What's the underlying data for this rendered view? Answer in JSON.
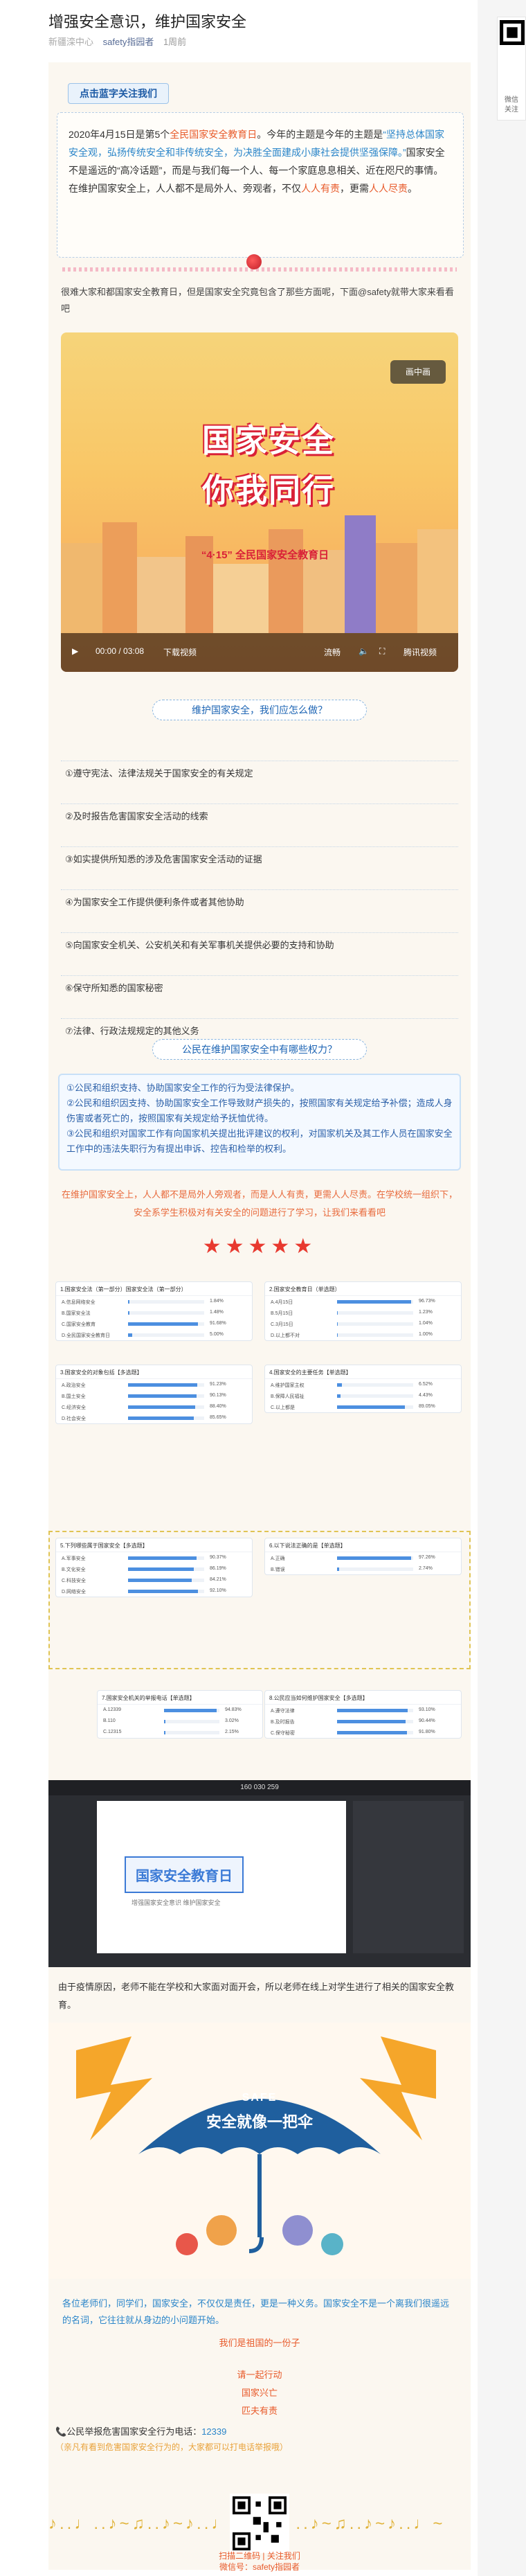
{
  "article": {
    "title": "增强安全意识，维护国家安全",
    "source": "新疆滦中心",
    "account": "safety指园者",
    "date": "1周前"
  },
  "side_qr": {
    "label": "微信\n关注"
  },
  "notice": {
    "heading": "点击蓝字关注我们",
    "p1_a": "2020年4月15日是第5个",
    "p1_b": "全民国家安全教育日",
    "p1_c": "。今年的主题是今年的主题是",
    "p1_d": "“坚持总体国家安全观，弘扬传统安全和非传统安全，为决胜全面建成小康社会提供坚强保障。”",
    "p1_e": "国家安全不是遥远的“高冷话题”，而是与我们每一个人、每一个家庭息息相关、近在咫尺的事情。",
    "p2_a": "在维护国家安全上，人人都不是局外人、旁观者，不仅",
    "p2_b": "人人有责",
    "p2_c": "，更需",
    "p2_d": "人人尽责",
    "p2_e": "。"
  },
  "intro": "很难大家和都国家安全教育日，但是国家安全究竟包含了那些方面呢，下面@safety就带大家来看看吧",
  "video": {
    "badge": "画中画",
    "title_line1": "国家安全",
    "title_line2": "你我同行",
    "subtitle": "“4·15” 全民国家安全教育日",
    "time": "00:00 / 03:08",
    "download": "下载视频",
    "quality": "流畅",
    "brand": "腾讯视频"
  },
  "section2": {
    "title": "维护国家安全，我们应怎么做？",
    "items": [
      "①遵守宪法、法律法规关于国家安全的有关规定",
      "②及时报告危害国家安全活动的线索",
      "③如实提供所知悉的涉及危害国家安全活动的证据",
      "④为国家安全工作提供便利条件或者其他协助",
      "⑤向国家安全机关、公安机关和有关军事机关提供必要的支持和协助",
      "⑥保守所知悉的国家秘密",
      "⑦法律、行政法规规定的其他义务"
    ]
  },
  "section3": {
    "title": "公民在维护国家安全中有哪些权力？",
    "rights": [
      "①公民和组织支持、协助国家安全工作的行为受法律保护。",
      "②公民和组织因支持、协助国家安全工作导致财产损失的，按照国家有关规定给予补偿；造成人身伤害或者死亡的，按照国家有关规定给予抚恤优待。",
      "③公民和组织对国家工作有向国家机关提出批评建议的权利，对国家机关及其工作人员在国家安全工作中的违法失职行为有提出申诉、控告和检举的权利。"
    ],
    "note": "在维护国家安全上，人人都不是局外人旁观者，而是人人有责，更需人人尽责。在学校统一组织下，安全系学生积极对有关安全的问题进行了学习，让我们来看看吧",
    "stars": "★★★★★"
  },
  "survey": {
    "panels": [
      {
        "head": "1.国家安全法（第一部分）国家安全法（第一部分）",
        "rows": [
          {
            "label": "A.信息网络安全",
            "pct": "1.84%",
            "val": 0.02
          },
          {
            "label": "B.国家安全法",
            "pct": "1.48%",
            "val": 0.015
          },
          {
            "label": "C.国家安全教育",
            "pct": "91.68%",
            "val": 0.92
          },
          {
            "label": "D.全民国家安全教育日",
            "pct": "5.00%",
            "val": 0.05
          }
        ]
      },
      {
        "head": "2.国家安全教育日（单选题）",
        "rows": [
          {
            "label": "A.4月15日",
            "pct": "96.73%",
            "val": 0.97
          },
          {
            "label": "B.5月15日",
            "pct": "1.23%",
            "val": 0.012
          },
          {
            "label": "C.3月15日",
            "pct": "1.04%",
            "val": 0.01
          },
          {
            "label": "D.以上都不对",
            "pct": "1.00%",
            "val": 0.01
          }
        ]
      },
      {
        "head": "3.国家安全的对象包括【多选题】",
        "rows": [
          {
            "label": "A.政治安全",
            "pct": "91.23%",
            "val": 0.91
          },
          {
            "label": "B.国土安全",
            "pct": "90.13%",
            "val": 0.9
          },
          {
            "label": "C.经济安全",
            "pct": "88.40%",
            "val": 0.88
          },
          {
            "label": "D.社会安全",
            "pct": "85.65%",
            "val": 0.86
          }
        ]
      },
      {
        "head": "4.国家安全的主要任务【单选题】",
        "rows": [
          {
            "label": "A.维护国家主权",
            "pct": "6.52%",
            "val": 0.065
          },
          {
            "label": "B.保障人民福祉",
            "pct": "4.43%",
            "val": 0.044
          },
          {
            "label": "C.以上都是",
            "pct": "89.05%",
            "val": 0.89
          }
        ]
      },
      {
        "head": "5.下列哪些属于国家安全【多选题】",
        "rows": [
          {
            "label": "A.军事安全",
            "pct": "90.37%",
            "val": 0.9
          },
          {
            "label": "B.文化安全",
            "pct": "86.19%",
            "val": 0.86
          },
          {
            "label": "C.科技安全",
            "pct": "84.21%",
            "val": 0.84
          },
          {
            "label": "D.网络安全",
            "pct": "92.10%",
            "val": 0.92
          }
        ]
      },
      {
        "head": "6.以下说法正确的是【单选题】",
        "rows": [
          {
            "label": "A.正确",
            "pct": "97.26%",
            "val": 0.97
          },
          {
            "label": "B.错误",
            "pct": "2.74%",
            "val": 0.027
          }
        ]
      },
      {
        "head": "7.国家安全机关的举报电话【单选题】",
        "rows": [
          {
            "label": "A.12339",
            "pct": "94.83%",
            "val": 0.95
          },
          {
            "label": "B.110",
            "pct": "3.02%",
            "val": 0.03
          },
          {
            "label": "C.12315",
            "pct": "2.15%",
            "val": 0.02
          }
        ]
      },
      {
        "head": "8.公民应当如何维护国家安全【多选题】",
        "rows": [
          {
            "label": "A.遵守法律",
            "pct": "93.10%",
            "val": 0.93
          },
          {
            "label": "B.及时报告",
            "pct": "90.44%",
            "val": 0.9
          },
          {
            "label": "C.保守秘密",
            "pct": "91.80%",
            "val": 0.92
          }
        ]
      }
    ]
  },
  "live": {
    "topbar": "160 030 259",
    "slide_title": "国家安全教育日",
    "slide_sub": "增强国家安全意识 维护国家安全"
  },
  "covid_note": "由于疫情原因，老师不能在学校和大家面对面开会，所以老师在线上对学生进行了相关的国家安全教育。",
  "umbrella": {
    "safe": "SAFE",
    "caption": "安全就像一把伞"
  },
  "closing": {
    "p1": "各位老师们，同学们，国家安全，不仅仅是责任，更是一种义务。国家安全不是一个离我们很遥远的名词，它往往就从身边的小问题开始。",
    "p2": "我们是祖国的一份子",
    "p3": "请一起行动",
    "p4": "国家兴亡",
    "p5": "匹夫有责"
  },
  "hotline": {
    "line1": "公民举报危害国家安全行为电话：",
    "number": "12339",
    "line2": "（亲凡有看到危害国家安全行为的，大家都可以打电话举报哦）"
  },
  "footer": {
    "notes": "♪..♩..♪~♫..♪~♪..♩~ ♪..♩..♪~♫..♪~♪..♩~",
    "scan": "扫描二维码 | 关注我们",
    "account": "微信号：safety指园者"
  },
  "colors": {
    "accent_blue": "#2a85c9",
    "accent_red": "#e85a2a",
    "page_bg": "#fbf7f0"
  }
}
